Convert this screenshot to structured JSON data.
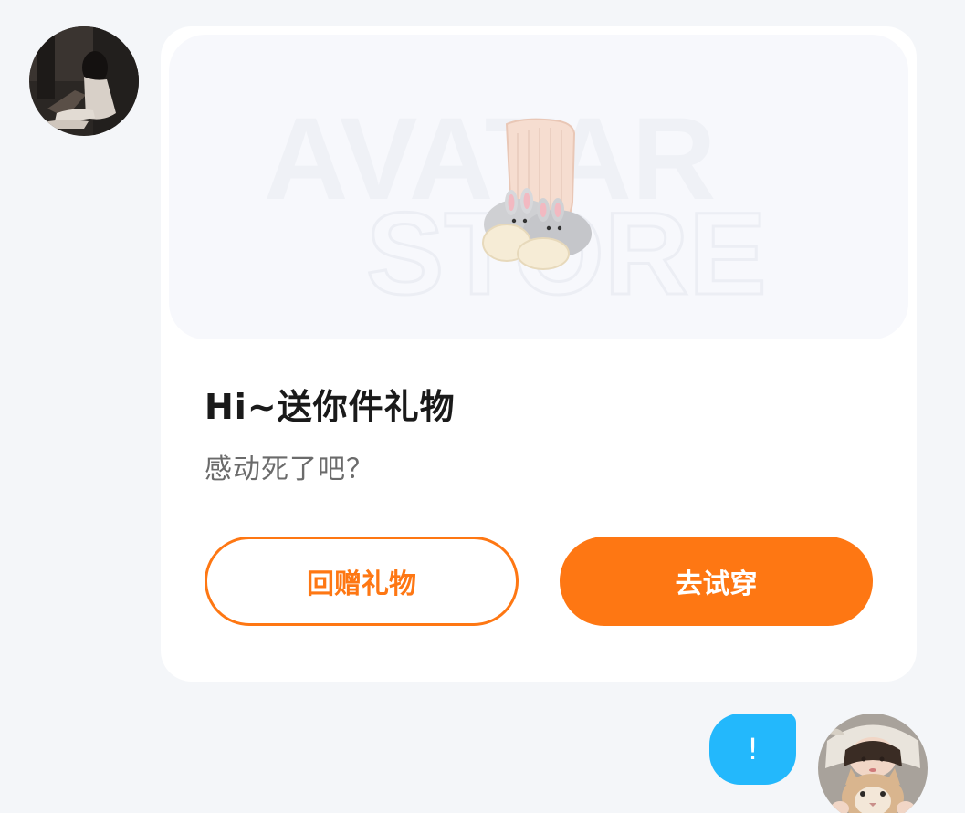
{
  "chat": {
    "incoming": {
      "avatar_icon": "user-avatar-girl-sitting",
      "gift_card": {
        "watermark_line1": "AVATAR",
        "watermark_line2": "STORE",
        "gift_item_icon": "bunny-slipper-socks",
        "title": "Hi~送你件礼物",
        "subtitle": "感动死了吧？",
        "return_gift_label": "回赠礼物",
        "try_on_label": "去试穿"
      }
    },
    "outgoing": {
      "message": "!",
      "avatar_icon": "user-avatar-girl-with-cat"
    }
  },
  "colors": {
    "page_bg": "#f4f6f9",
    "accent_orange": "#fe7713",
    "bubble_blue": "#23b8fc",
    "card_bg": "#ffffff",
    "preview_bg": "#f7f8fc"
  }
}
